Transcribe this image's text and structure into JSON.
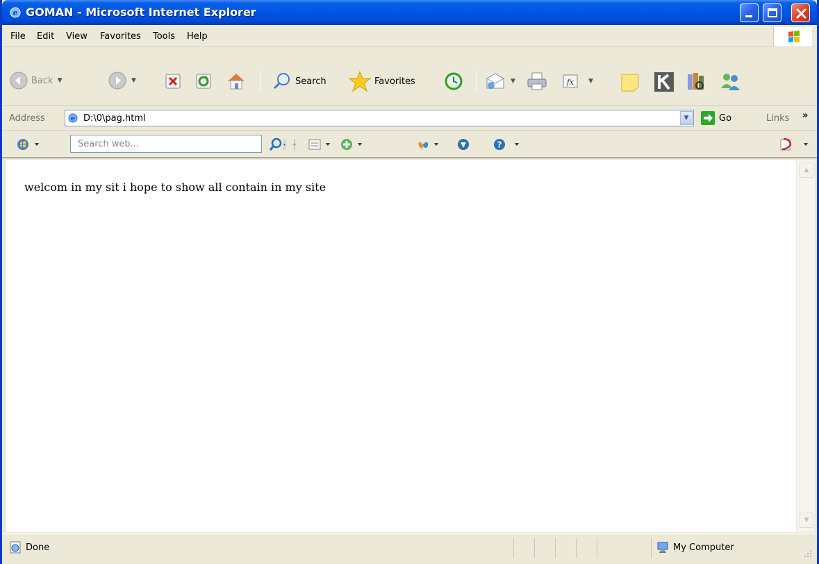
{
  "window": {
    "title": "GOMAN - Microsoft Internet Explorer",
    "title_icon": "ie-icon",
    "controls": [
      "minimize-icon",
      "maximize-icon",
      "close-icon"
    ]
  },
  "menu": {
    "items": [
      "File",
      "Edit",
      "View",
      "Favorites",
      "Tools",
      "Help"
    ]
  },
  "toolbar": {
    "back_label": "Back",
    "search_label": "Search",
    "favorites_label": "Favorites"
  },
  "address": {
    "label": "Address",
    "value": "D:\\0\\pag.html",
    "go_label": "Go",
    "links_label": "Links",
    "chevron": "»"
  },
  "searchbar": {
    "placeholder": "Search web..."
  },
  "page": {
    "text": "welcom in my sit i hope to show all contain in my site"
  },
  "status": {
    "left": "Done",
    "zone": "My Computer"
  },
  "colors": {
    "titlebar": "#0055e5",
    "chrome": "#ece9d8",
    "close_button": "#e0432a"
  }
}
